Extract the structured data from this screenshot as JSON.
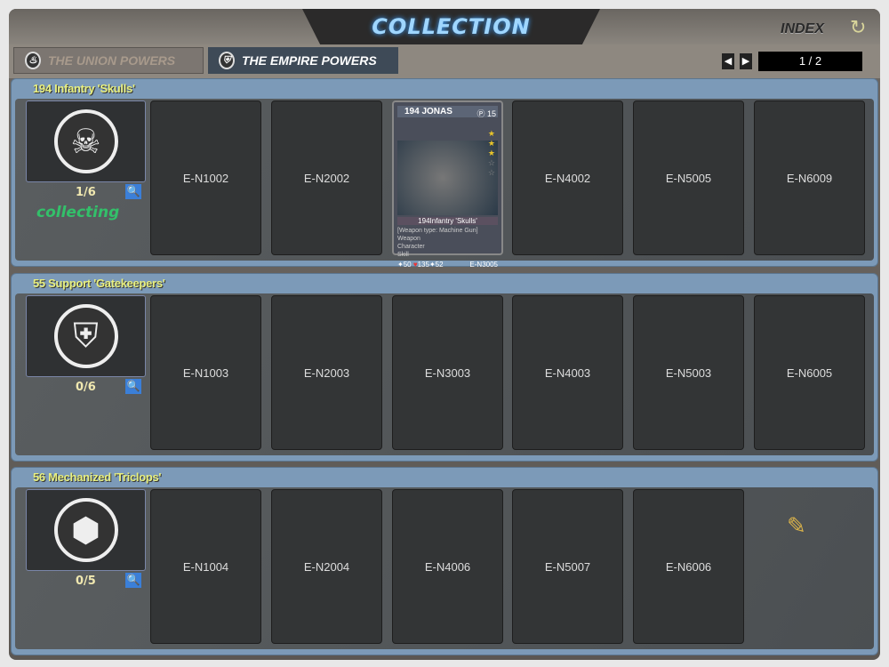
{
  "header": {
    "title": "COLLECTION",
    "index_label": "INDEX",
    "refresh_icon": "refresh-icon"
  },
  "tabs": [
    {
      "label": "THE UNION POWERS",
      "active": false
    },
    {
      "label": "THE EMPIRE POWERS",
      "active": true
    }
  ],
  "pagination": {
    "prev": "◀",
    "next": "▶",
    "page": "1 / 2"
  },
  "sections": [
    {
      "title": "194 Infantry 'Skulls'",
      "emblem": "☠",
      "count": "1/6",
      "status": "collecting",
      "cards": [
        "E-N1002",
        "E-N2002",
        "",
        "E-N4002",
        "E-N5005",
        "E-N6009"
      ]
    },
    {
      "title": "55 Support 'Gatekeepers'",
      "emblem": "⛨",
      "count": "0/6",
      "cards": [
        "E-N1003",
        "E-N2003",
        "E-N3003",
        "E-N4003",
        "E-N5003",
        "E-N6005"
      ]
    },
    {
      "title": "56 Mechanized 'Triclops'",
      "emblem": "⬢",
      "count": "0/5",
      "cards": [
        "E-N1004",
        "E-N2004",
        "E-N4006",
        "E-N5007",
        "E-N6006"
      ]
    }
  ],
  "owned_card": {
    "name": "194 JONAS",
    "cost": "15",
    "stars": 3,
    "max_stars": 5,
    "unit": "194Infantry 'Skulls'",
    "weapon": "[Weapon type: Machine Gun]",
    "lines": [
      "Weapon",
      "Character",
      "Skill"
    ],
    "attack": "50",
    "hp": "135",
    "defense": "52",
    "code": "E-N3005"
  }
}
